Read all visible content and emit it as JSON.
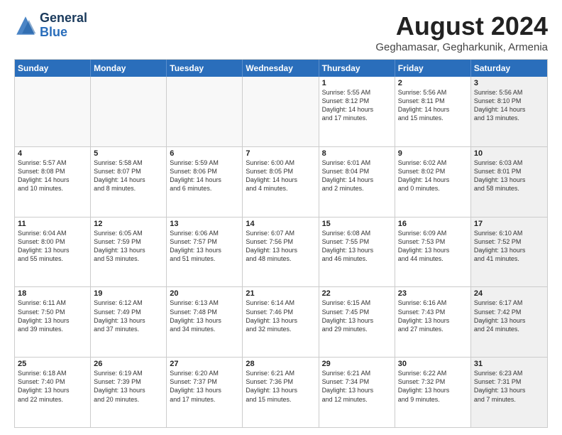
{
  "logo": {
    "line1": "General",
    "line2": "Blue"
  },
  "title": "August 2024",
  "subtitle": "Geghamasar, Gegharkunik, Armenia",
  "dayHeaders": [
    "Sunday",
    "Monday",
    "Tuesday",
    "Wednesday",
    "Thursday",
    "Friday",
    "Saturday"
  ],
  "weeks": [
    [
      {
        "num": "",
        "info": "",
        "empty": true
      },
      {
        "num": "",
        "info": "",
        "empty": true
      },
      {
        "num": "",
        "info": "",
        "empty": true
      },
      {
        "num": "",
        "info": "",
        "empty": true
      },
      {
        "num": "1",
        "info": "Sunrise: 5:55 AM\nSunset: 8:12 PM\nDaylight: 14 hours\nand 17 minutes."
      },
      {
        "num": "2",
        "info": "Sunrise: 5:56 AM\nSunset: 8:11 PM\nDaylight: 14 hours\nand 15 minutes."
      },
      {
        "num": "3",
        "info": "Sunrise: 5:56 AM\nSunset: 8:10 PM\nDaylight: 14 hours\nand 13 minutes.",
        "shaded": true
      }
    ],
    [
      {
        "num": "4",
        "info": "Sunrise: 5:57 AM\nSunset: 8:08 PM\nDaylight: 14 hours\nand 10 minutes."
      },
      {
        "num": "5",
        "info": "Sunrise: 5:58 AM\nSunset: 8:07 PM\nDaylight: 14 hours\nand 8 minutes."
      },
      {
        "num": "6",
        "info": "Sunrise: 5:59 AM\nSunset: 8:06 PM\nDaylight: 14 hours\nand 6 minutes."
      },
      {
        "num": "7",
        "info": "Sunrise: 6:00 AM\nSunset: 8:05 PM\nDaylight: 14 hours\nand 4 minutes."
      },
      {
        "num": "8",
        "info": "Sunrise: 6:01 AM\nSunset: 8:04 PM\nDaylight: 14 hours\nand 2 minutes."
      },
      {
        "num": "9",
        "info": "Sunrise: 6:02 AM\nSunset: 8:02 PM\nDaylight: 14 hours\nand 0 minutes."
      },
      {
        "num": "10",
        "info": "Sunrise: 6:03 AM\nSunset: 8:01 PM\nDaylight: 13 hours\nand 58 minutes.",
        "shaded": true
      }
    ],
    [
      {
        "num": "11",
        "info": "Sunrise: 6:04 AM\nSunset: 8:00 PM\nDaylight: 13 hours\nand 55 minutes."
      },
      {
        "num": "12",
        "info": "Sunrise: 6:05 AM\nSunset: 7:59 PM\nDaylight: 13 hours\nand 53 minutes."
      },
      {
        "num": "13",
        "info": "Sunrise: 6:06 AM\nSunset: 7:57 PM\nDaylight: 13 hours\nand 51 minutes."
      },
      {
        "num": "14",
        "info": "Sunrise: 6:07 AM\nSunset: 7:56 PM\nDaylight: 13 hours\nand 48 minutes."
      },
      {
        "num": "15",
        "info": "Sunrise: 6:08 AM\nSunset: 7:55 PM\nDaylight: 13 hours\nand 46 minutes."
      },
      {
        "num": "16",
        "info": "Sunrise: 6:09 AM\nSunset: 7:53 PM\nDaylight: 13 hours\nand 44 minutes."
      },
      {
        "num": "17",
        "info": "Sunrise: 6:10 AM\nSunset: 7:52 PM\nDaylight: 13 hours\nand 41 minutes.",
        "shaded": true
      }
    ],
    [
      {
        "num": "18",
        "info": "Sunrise: 6:11 AM\nSunset: 7:50 PM\nDaylight: 13 hours\nand 39 minutes."
      },
      {
        "num": "19",
        "info": "Sunrise: 6:12 AM\nSunset: 7:49 PM\nDaylight: 13 hours\nand 37 minutes."
      },
      {
        "num": "20",
        "info": "Sunrise: 6:13 AM\nSunset: 7:48 PM\nDaylight: 13 hours\nand 34 minutes."
      },
      {
        "num": "21",
        "info": "Sunrise: 6:14 AM\nSunset: 7:46 PM\nDaylight: 13 hours\nand 32 minutes."
      },
      {
        "num": "22",
        "info": "Sunrise: 6:15 AM\nSunset: 7:45 PM\nDaylight: 13 hours\nand 29 minutes."
      },
      {
        "num": "23",
        "info": "Sunrise: 6:16 AM\nSunset: 7:43 PM\nDaylight: 13 hours\nand 27 minutes."
      },
      {
        "num": "24",
        "info": "Sunrise: 6:17 AM\nSunset: 7:42 PM\nDaylight: 13 hours\nand 24 minutes.",
        "shaded": true
      }
    ],
    [
      {
        "num": "25",
        "info": "Sunrise: 6:18 AM\nSunset: 7:40 PM\nDaylight: 13 hours\nand 22 minutes."
      },
      {
        "num": "26",
        "info": "Sunrise: 6:19 AM\nSunset: 7:39 PM\nDaylight: 13 hours\nand 20 minutes."
      },
      {
        "num": "27",
        "info": "Sunrise: 6:20 AM\nSunset: 7:37 PM\nDaylight: 13 hours\nand 17 minutes."
      },
      {
        "num": "28",
        "info": "Sunrise: 6:21 AM\nSunset: 7:36 PM\nDaylight: 13 hours\nand 15 minutes."
      },
      {
        "num": "29",
        "info": "Sunrise: 6:21 AM\nSunset: 7:34 PM\nDaylight: 13 hours\nand 12 minutes."
      },
      {
        "num": "30",
        "info": "Sunrise: 6:22 AM\nSunset: 7:32 PM\nDaylight: 13 hours\nand 9 minutes."
      },
      {
        "num": "31",
        "info": "Sunrise: 6:23 AM\nSunset: 7:31 PM\nDaylight: 13 hours\nand 7 minutes.",
        "shaded": true
      }
    ]
  ]
}
